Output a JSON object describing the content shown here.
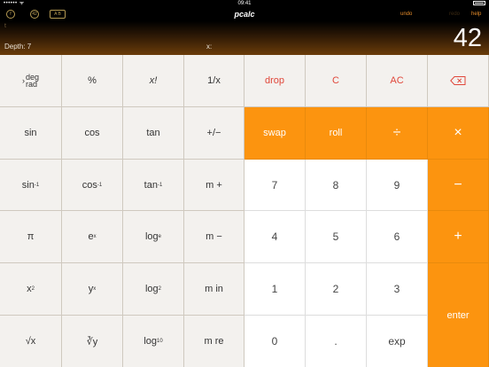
{
  "status_bar": {
    "carrier": "•••••• ᯤ",
    "time": "09:41"
  },
  "toolbar": {
    "icon_left1": "f",
    "icon_left2": "42",
    "icon_left3": "A B",
    "title": "pcalc",
    "undo": "undo",
    "redo": "redo",
    "help": "help"
  },
  "display": {
    "faint": "t",
    "depth": "Depth: 7",
    "x_label": "x:",
    "value": "42"
  },
  "keys": {
    "deg_rad_top": "deg",
    "deg_rad_bottom": "rad",
    "percent": "%",
    "factorial": "x!",
    "reciprocal": "1/x",
    "drop": "drop",
    "clear": "C",
    "all_clear": "AC",
    "sin": "sin",
    "cos": "cos",
    "tan": "tan",
    "plus_minus": "+/−",
    "swap": "swap",
    "roll": "roll",
    "divide": "÷",
    "multiply": "×",
    "asin": "sin",
    "acos": "cos",
    "atan": "tan",
    "inv_sup": "-1",
    "m_plus": "m +",
    "seven": "7",
    "eight": "8",
    "nine": "9",
    "minus": "−",
    "pi": "π",
    "e_power": "e",
    "e_sup": "x",
    "loge": "log",
    "loge_sub": "e",
    "m_minus": "m −",
    "four": "4",
    "five": "5",
    "six": "6",
    "plus": "+",
    "x_squared": "x",
    "x_sq_sup": "2",
    "y_power": "y",
    "y_sup": "x",
    "log2": "log",
    "log2_sub": "2",
    "m_in": "m in",
    "one": "1",
    "two": "2",
    "three": "3",
    "enter": "enter",
    "sqrt": "√x",
    "xroot": "∛y",
    "log10": "log",
    "log10_sub": "10",
    "m_re": "m re",
    "zero": "0",
    "decimal": ".",
    "exp": "exp"
  },
  "colors": {
    "accent_orange": "#fc940f",
    "red_text": "#e0473a",
    "display_gradient_end": "#6a3c0a"
  }
}
